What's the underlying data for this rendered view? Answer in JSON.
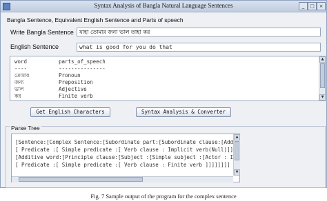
{
  "window": {
    "title": "Syntax Analysis of Bangla Natural Language Sentences"
  },
  "input_section": {
    "group_title": "Bangla Sentence, Equivalent English Sentence and Parts of speech",
    "bangla_label": "Write Bangla Sentence",
    "bangla_value": "যাহা তোমার জন্য ভাল তাহা কর",
    "english_label": "English Sentence",
    "english_value": "what is good for you do that"
  },
  "pos_table": {
    "header": [
      "word",
      "parts_of_speech"
    ],
    "separator": [
      "----",
      "---------------"
    ],
    "rows": [
      [
        "তোমার",
        "Pronoun"
      ],
      [
        "জন্য",
        "Preposition"
      ],
      [
        "ভাল",
        "Adjective"
      ],
      [
        "কর",
        "Finite verb"
      ]
    ]
  },
  "buttons": {
    "get_english": "Get English Characters",
    "syntax_convert": "Syntax Analysis & Converter"
  },
  "parse_tree": {
    "group_title": "Parse Tree",
    "lines": [
      "[Sentence:[Complex Sentence:[Subordinate part:[Subordinate clause:[Add",
      "[ Predicate :[ Simple predicate :[ Verb clause : Implicit verb(Null)]]",
      "[Additive word:[Principle clause:[Subject :[Simple subject :[Actor : Im",
      "[ Predicate :[ Simple predicate :[ Verb clause : Finite verb ]]]]]]]]"
    ]
  },
  "caption": "Fig. 7 Sample output of the program for the complex sentence"
}
